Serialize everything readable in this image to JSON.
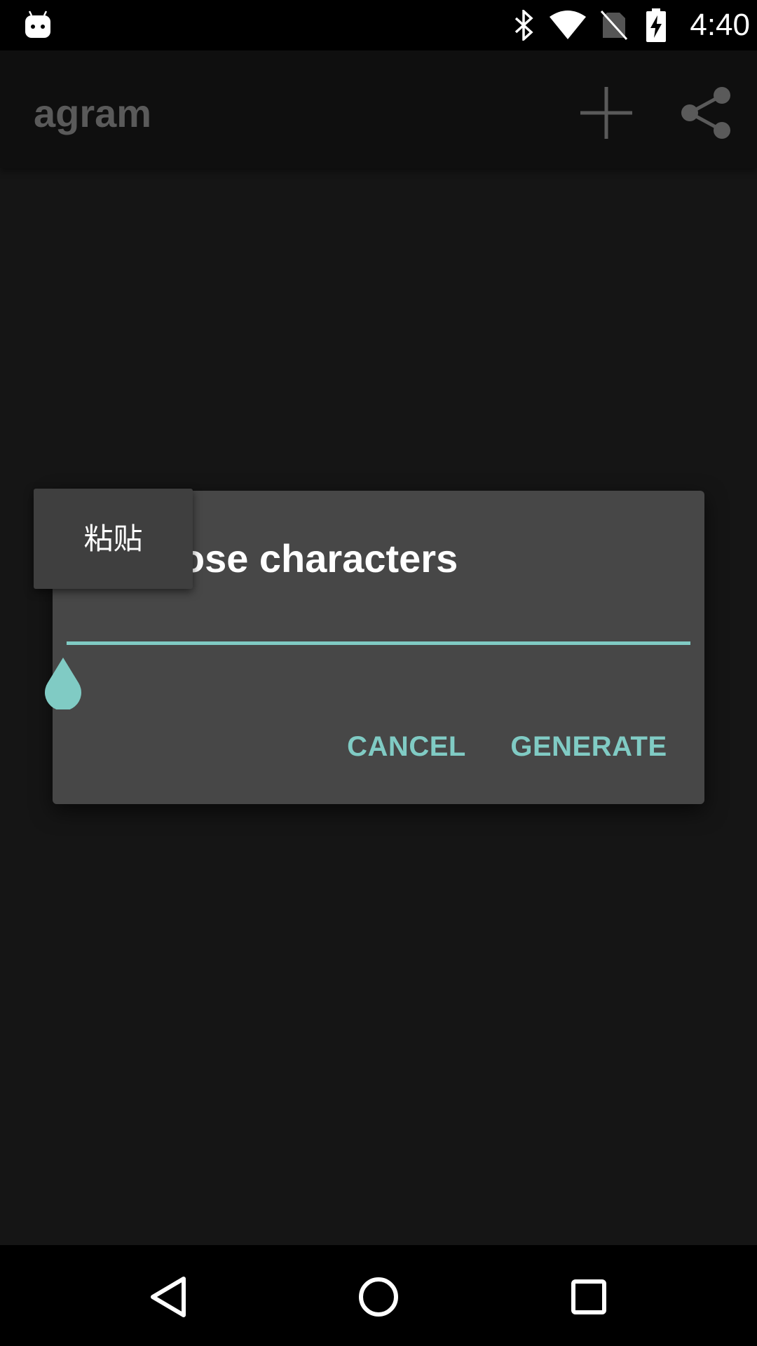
{
  "status_bar": {
    "time": "4:40",
    "icons": [
      "android-notification-icon",
      "bluetooth-icon",
      "wifi-icon",
      "no-sim-icon",
      "battery-charging-icon"
    ]
  },
  "app_bar": {
    "title": "agram",
    "actions": [
      "add-icon",
      "share-icon"
    ]
  },
  "dialog": {
    "title": "Choose characters",
    "input_value": "",
    "cancel_label": "CANCEL",
    "generate_label": "GENERATE"
  },
  "paste_popup": {
    "label": "粘贴"
  },
  "nav_bar": {
    "buttons": [
      "back-icon",
      "home-icon",
      "recents-icon"
    ]
  },
  "colors": {
    "accent": "#80cbc4",
    "dialog_bg": "#474747",
    "screen_bg": "#151515"
  }
}
